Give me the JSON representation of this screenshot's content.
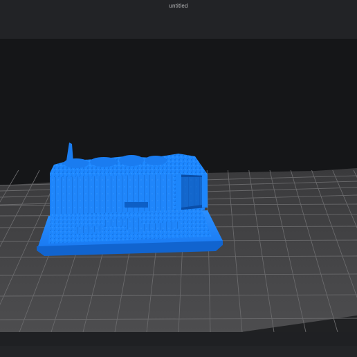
{
  "window": {
    "title": "untitled"
  },
  "viewport": {
    "background_color": "#151618",
    "build_plate_color": "#4a4a4c",
    "grid_color": "#6b6b6d",
    "model_color": "#1e88ff",
    "model_description_icon": "3d-model-trench-diorama"
  }
}
